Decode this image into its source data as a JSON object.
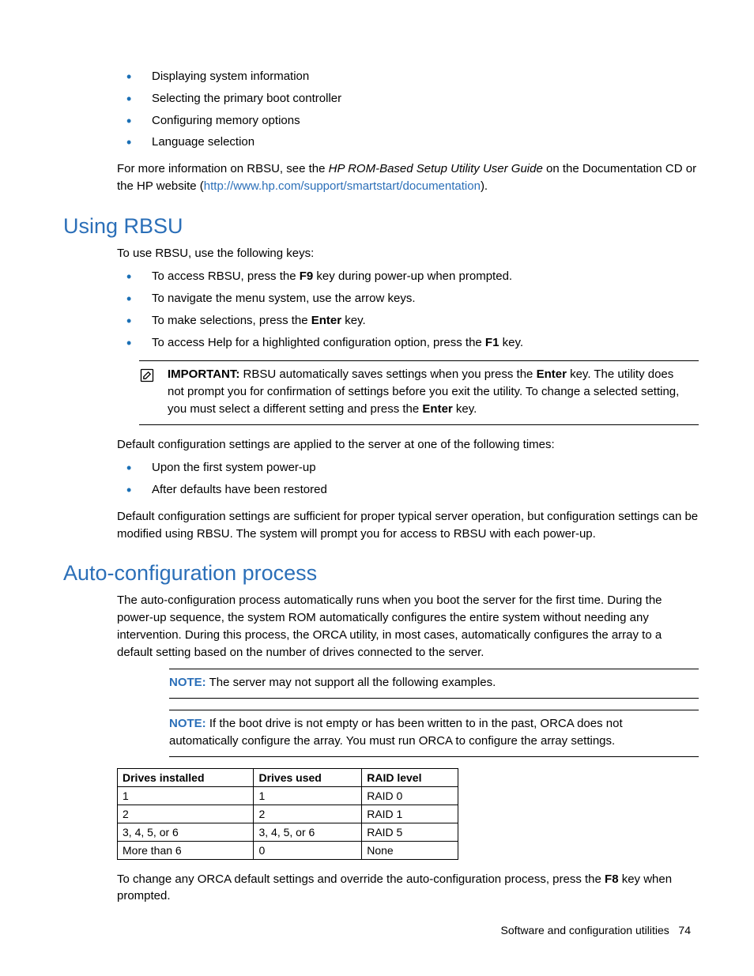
{
  "intro_bullets": [
    "Displaying system information",
    "Selecting the primary boot controller",
    "Configuring memory options",
    "Language selection"
  ],
  "intro_para_before": "For more information on RBSU, see the ",
  "intro_para_italic": "HP ROM-Based Setup Utility User Guide",
  "intro_para_mid": " on the Documentation CD or the HP website (",
  "intro_link": "http://www.hp.com/support/smartstart/documentation",
  "intro_para_end": ").",
  "using": {
    "heading": "Using RBSU",
    "lead": "To use RBSU, use the following keys:",
    "bullets": [
      {
        "pre": "To access RBSU, press the ",
        "bold": "F9",
        "post": " key during power-up when prompted."
      },
      {
        "pre": "To navigate the menu system, use the arrow keys.",
        "bold": "",
        "post": ""
      },
      {
        "pre": "To make selections, press the ",
        "bold": "Enter",
        "post": " key."
      },
      {
        "pre": "To access Help for a highlighted configuration option, press the ",
        "bold": "F1",
        "post": " key."
      }
    ],
    "important_label": "IMPORTANT:",
    "important_pre": "   RBSU automatically saves settings when you press the ",
    "important_bold1": "Enter",
    "important_mid": " key. The utility does not prompt you for confirmation of settings before you exit the utility. To change a selected setting, you must select a different setting and press the ",
    "important_bold2": "Enter",
    "important_post": " key.",
    "defaults_para": "Default configuration settings are applied to the server at one of the following times:",
    "defaults_bullets": [
      "Upon the first system power-up",
      "After defaults have been restored"
    ],
    "closing": "Default configuration settings are sufficient for proper typical server operation, but configuration settings can be modified using RBSU. The system will prompt you for access to RBSU with each power-up."
  },
  "auto": {
    "heading": "Auto-configuration process",
    "para": "The auto-configuration process automatically runs when you boot the server for the first time. During the power-up sequence, the system ROM automatically configures the entire system without needing any intervention. During this process, the ORCA utility, in most cases, automatically configures the array to a default setting based on the number of drives connected to the server.",
    "note1_label": "NOTE:",
    "note1_text": "   The server may not support all the following examples.",
    "note2_label": "NOTE:",
    "note2_text": "   If the boot drive is not empty or has been written to in the past, ORCA does not automatically configure the array. You must run ORCA to configure the array settings.",
    "table": {
      "headers": [
        "Drives installed",
        "Drives used",
        "RAID level"
      ],
      "rows": [
        [
          "1",
          "1",
          "RAID 0"
        ],
        [
          "2",
          "2",
          "RAID 1"
        ],
        [
          "3, 4, 5, or 6",
          "3, 4, 5, or 6",
          "RAID 5"
        ],
        [
          "More than 6",
          "0",
          "None"
        ]
      ]
    },
    "closing_pre": "To change any ORCA default settings and override the auto-configuration process, press the ",
    "closing_bold": "F8",
    "closing_post": " key when prompted."
  },
  "footer": {
    "text": "Software and configuration utilities",
    "page": "74"
  }
}
